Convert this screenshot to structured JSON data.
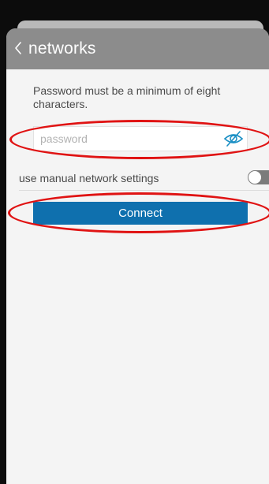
{
  "header": {
    "title": "networks",
    "back_icon": "chevron-left-icon"
  },
  "form": {
    "hint": "Password must be a minimum of eight characters.",
    "password": {
      "value": "",
      "placeholder": "password",
      "visibility_icon": "eye-slash-icon",
      "icon_color": "#1a8fc4"
    },
    "manual_settings": {
      "label": "use manual network settings",
      "enabled": false
    },
    "connect_label": "Connect"
  },
  "colors": {
    "header_bg": "#8c8c8c",
    "button_bg": "#0f70ae",
    "annotation": "#e01313"
  }
}
